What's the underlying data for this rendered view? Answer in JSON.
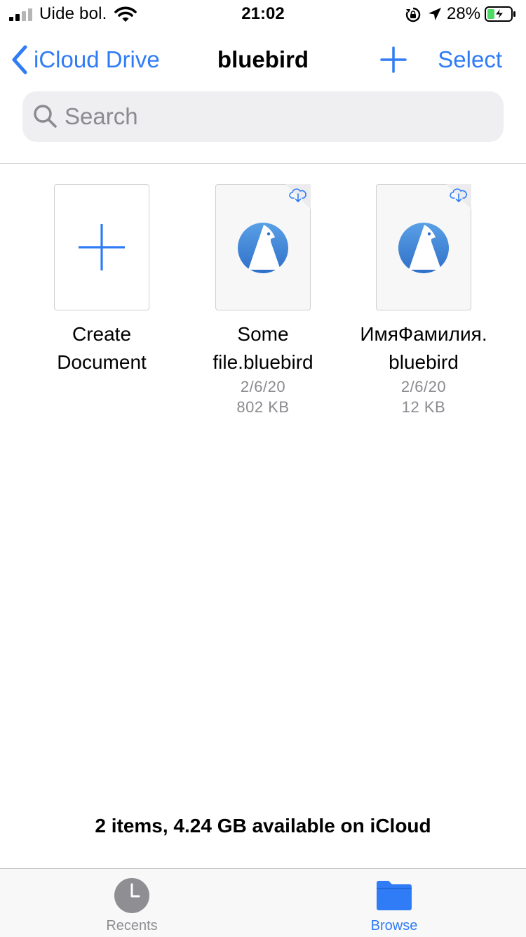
{
  "status_bar": {
    "carrier": "Uide bol.",
    "time": "21:02",
    "battery_percent": "28%",
    "icons": [
      "signal-icon",
      "wifi-icon",
      "orientation-lock-icon",
      "location-icon",
      "battery-charging-icon"
    ]
  },
  "nav": {
    "back_label": "iCloud Drive",
    "title": "bluebird",
    "select_label": "Select",
    "icons": [
      "chevron-left-icon",
      "plus-icon"
    ]
  },
  "search": {
    "placeholder": "Search"
  },
  "items": [
    {
      "name_line1": "Create",
      "name_line2": "Document",
      "icon": "plus-icon"
    },
    {
      "name_line1": "Some",
      "name_line2": "file.bluebird",
      "date": "2/6/20",
      "size": "802 KB",
      "icon": "bluebird-app-icon"
    },
    {
      "name_line1": "ИмяФамилия.",
      "name_line2": "bluebird",
      "date": "2/6/20",
      "size": "12 KB",
      "icon": "bluebird-app-icon"
    }
  ],
  "summary": "2 items, 4.24 GB available on iCloud",
  "tabs": [
    {
      "label": "Recents",
      "icon": "clock-icon",
      "selected": false
    },
    {
      "label": "Browse",
      "icon": "folder-icon",
      "selected": true
    }
  ],
  "colors": {
    "accent": "#2f7cf6",
    "secondary_text": "#8a8a8f",
    "search_bg": "#efeff1",
    "battery_fill": "#4cd964"
  }
}
